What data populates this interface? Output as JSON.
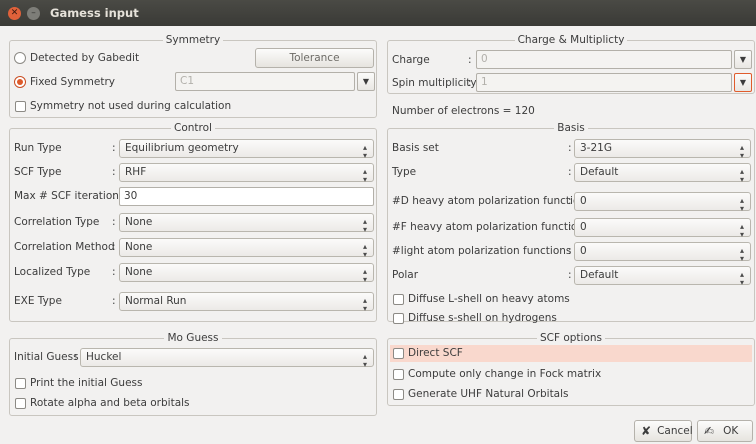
{
  "window": {
    "title": "Gamess input"
  },
  "symmetry": {
    "title": "Symmetry",
    "detected_label": "Detected by Gabedit",
    "tolerance_label": "Tolerance",
    "fixed_label": "Fixed Symmetry",
    "fixed_value": "C1",
    "not_used_label": "Symmetry not used during calculation"
  },
  "charge": {
    "title": "Charge & Multiplicty",
    "charge_label": "Charge",
    "charge_value": "0",
    "spin_label": "Spin multiplicity",
    "spin_value": "1",
    "electrons_text": "Number of electrons = 120"
  },
  "control": {
    "title": "Control",
    "run_type_label": "Run Type",
    "run_type_value": "Equilibrium geometry",
    "scf_type_label": "SCF Type",
    "scf_type_value": "RHF",
    "max_iter_label": "Max # SCF iterations",
    "max_iter_value": "30",
    "corr_type_label": "Correlation Type",
    "corr_type_value": "None",
    "corr_method_label": "Correlation Method",
    "corr_method_value": "None",
    "localized_label": "Localized Type",
    "localized_value": "None",
    "exe_label": "EXE Type",
    "exe_value": "Normal Run"
  },
  "basis": {
    "title": "Basis",
    "basis_set_label": "Basis set",
    "basis_set_value": "3-21G",
    "type_label": "Type",
    "type_value": "Default",
    "d_heavy_label": "#D heavy atom polarization functions",
    "d_heavy_value": "0",
    "f_heavy_label": "#F heavy atom polarization functions",
    "f_heavy_value": "0",
    "light_label": "#light atom polarization functions",
    "light_value": "0",
    "polar_label": "Polar",
    "polar_value": "Default",
    "diffuse_l_label": "Diffuse L-shell on heavy atoms",
    "diffuse_s_label": "Diffuse s-shell on hydrogens"
  },
  "mo_guess": {
    "title": "Mo Guess",
    "initial_label": "Initial Guess",
    "initial_value": "Huckel",
    "print_label": "Print the initial Guess",
    "rotate_label": "Rotate alpha and beta orbitals"
  },
  "scf_options": {
    "title": "SCF options",
    "direct_label": "Direct SCF",
    "compute_label": "Compute only change in Fock matrix",
    "uhf_label": "Generate UHF Natural Orbitals"
  },
  "buttons": {
    "cancel_label": "Cancel",
    "ok_label": "OK"
  },
  "colors": {
    "accent": "#dd5a2a",
    "titlebar": "#3f3f3b",
    "highlight": "#f9d8cd"
  }
}
